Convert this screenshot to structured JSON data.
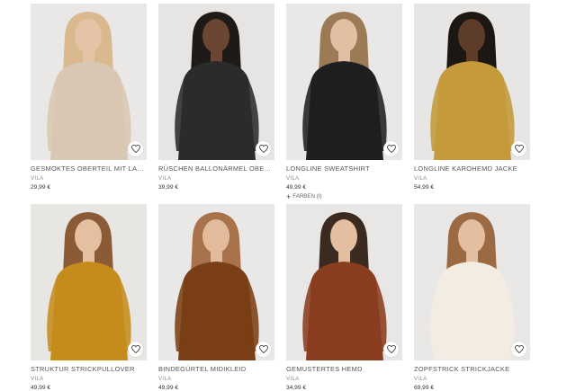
{
  "products": [
    {
      "title": "GESMOKTES OBERTEIL MIT LANGEN...",
      "brand": "VILA",
      "price": "29,99 €",
      "bg": "#e9e8e6",
      "garment": "#d8c7b2",
      "skin": "#e6c3a6",
      "hair": "#d9b98d"
    },
    {
      "title": "RÜSCHEN BALLONÄRMEL OBERTEIL ...",
      "brand": "VILA",
      "price": "39,99 €",
      "bg": "#e6e5e3",
      "garment": "#2b2b2b",
      "skin": "#6b4632",
      "hair": "#1e1a18"
    },
    {
      "title": "LONGLINE SWEATSHIRT",
      "brand": "VILA",
      "price": "49,99 €",
      "colors": "FARBEN (I)",
      "bg": "#e9e8e6",
      "garment": "#1f1f1f",
      "skin": "#e2bea2",
      "hair": "#9c7a56"
    },
    {
      "title": "LONGLINE KAROHEMD JACKE",
      "brand": "VILA",
      "price": "54,99 €",
      "bg": "#e7e6e4",
      "garment": "#c49a3a",
      "skin": "#5e3c2a",
      "hair": "#1d1714"
    },
    {
      "title": "STRUKTUR STRICKPULLOVER",
      "brand": "VILA",
      "price": "49,99 €",
      "bg": "#e8e6e3",
      "garment": "#c58c1c",
      "skin": "#e4bfa0",
      "hair": "#8b5a37"
    },
    {
      "title": "BINDEGÜRTEL MIDIKLEID",
      "brand": "VILA",
      "price": "49,99 €",
      "bg": "#e9e8e6",
      "garment": "#7a3f16",
      "skin": "#e1bb9c",
      "hair": "#a8724b"
    },
    {
      "title": "GEMUSTERTES HEMD",
      "brand": "VILA",
      "price": "34,99 €",
      "bg": "#e8e7e5",
      "garment": "#8a3d1f",
      "skin": "#e3bea1",
      "hair": "#3b2a20"
    },
    {
      "title": "ZOPFSTRICK STRICKJACKE",
      "brand": "VILA",
      "price": "69,99 €",
      "bg": "#e9e8e6",
      "garment": "#f2ece2",
      "skin": "#e3bea1",
      "hair": "#9b6a43"
    }
  ]
}
